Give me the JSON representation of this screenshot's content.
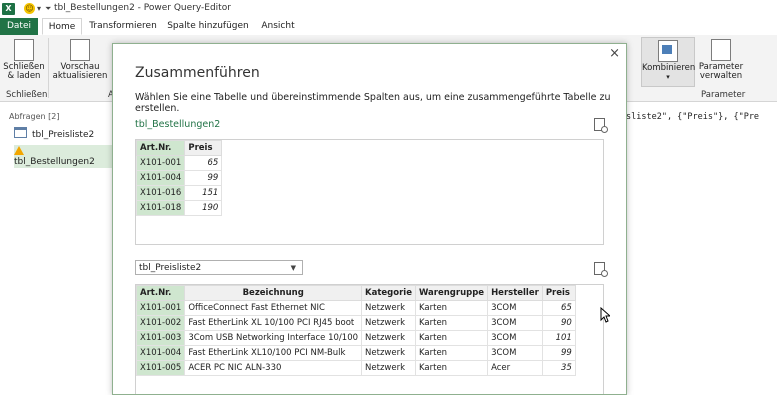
{
  "app": {
    "title": "tbl_Bestellungen2 - Power Query-Editor",
    "excel_icon_label": "X"
  },
  "tabs": [
    {
      "label": "Datei"
    },
    {
      "label": "Home"
    },
    {
      "label": "Transformieren"
    },
    {
      "label": "Spalte hinzufügen"
    },
    {
      "label": "Ansicht"
    }
  ],
  "ribbon": {
    "close_load": "Schließen & laden",
    "preview_refresh": "Vorschau aktualisieren",
    "group_close": "Schließen",
    "group_a": "A",
    "combine": "Kombinieren",
    "manage_params": "Parameter verwalten",
    "group_params": "Parameter"
  },
  "queries": {
    "header": "Abfragen [2]",
    "items": [
      {
        "label": "tbl_Preisliste2",
        "icon": "table-icon"
      },
      {
        "label": "tbl_Bestellungen2",
        "icon": "warning-icon",
        "selected": true
      }
    ]
  },
  "formula_fragment": "sliste2\", {\"Preis\"}, {\"Pre",
  "dialog": {
    "title": "Zusammenführen",
    "description": "Wählen Sie eine Tabelle und übereinstimmende Spalten aus, um eine zusammengeführte Tabelle zu erstellen.",
    "close_symbol": "×",
    "first_table": {
      "name": "tbl_Bestellungen2",
      "columns": [
        "Art.Nr.",
        "Preis"
      ],
      "rows": [
        [
          "X101-001",
          "65"
        ],
        [
          "X101-004",
          "99"
        ],
        [
          "X101-016",
          "151"
        ],
        [
          "X101-018",
          "190"
        ]
      ]
    },
    "second_table": {
      "selected": "tbl_Preisliste2",
      "columns": [
        "Art.Nr.",
        "Bezeichnung",
        "Kategorie",
        "Warengruppe",
        "Hersteller",
        "Preis"
      ],
      "rows": [
        [
          "X101-001",
          "OfficeConnect Fast Ethernet NIC",
          "Netzwerk",
          "Karten",
          "3COM",
          "65"
        ],
        [
          "X101-002",
          "Fast EtherLink XL 10/100 PCI RJ45 boot",
          "Netzwerk",
          "Karten",
          "3COM",
          "90"
        ],
        [
          "X101-003",
          "3Com USB Networking Interface 10/100",
          "Netzwerk",
          "Karten",
          "3COM",
          "101"
        ],
        [
          "X101-004",
          "Fast EtherLink XL10/100 PCI NM-Bulk",
          "Netzwerk",
          "Karten",
          "3COM",
          "99"
        ],
        [
          "X101-005",
          "ACER PC NIC ALN-330",
          "Netzwerk",
          "Karten",
          "Acer",
          "35"
        ]
      ]
    }
  }
}
